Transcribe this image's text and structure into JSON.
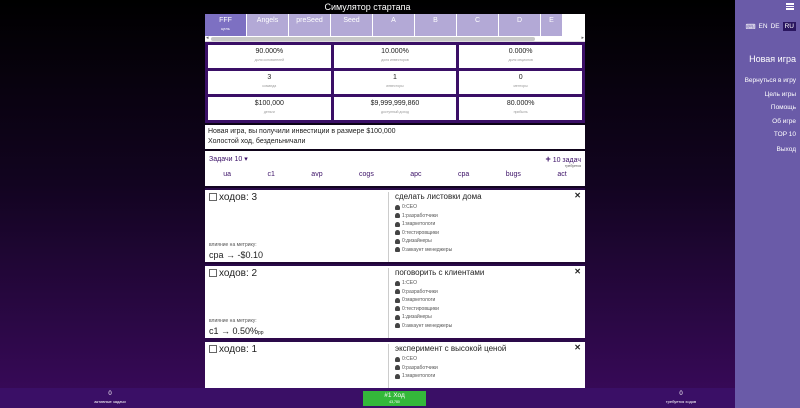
{
  "title": "Симулятор стартапа",
  "tabs": [
    {
      "label": "FFF",
      "sub": "цель"
    },
    {
      "label": "Angels",
      "sub": ""
    },
    {
      "label": "preSeed",
      "sub": ""
    },
    {
      "label": "Seed",
      "sub": ""
    },
    {
      "label": "A",
      "sub": ""
    },
    {
      "label": "B",
      "sub": ""
    },
    {
      "label": "C",
      "sub": ""
    },
    {
      "label": "D",
      "sub": ""
    },
    {
      "label": "E",
      "sub": ""
    }
  ],
  "metrics": [
    {
      "value": "90.000%",
      "label": "доля основателей"
    },
    {
      "value": "10.000%",
      "label": "доля инвесторов"
    },
    {
      "value": "0.000%",
      "label": "доля опционов"
    },
    {
      "value": "3",
      "label": "команда"
    },
    {
      "value": "1",
      "label": "инвесторы"
    },
    {
      "value": "0",
      "label": "менторы"
    },
    {
      "value": "$100,000",
      "label": "деньги"
    },
    {
      "value": "$9,999,999,860",
      "label": "доступный доход"
    },
    {
      "value": "80.000%",
      "label": "прибыль"
    }
  ],
  "log": [
    "Новая игра, вы получили инвестиции в размере $100,000",
    "Холостой ход, бездельничали"
  ],
  "tasks_dropdown": "Задачи 10",
  "add_tasks": {
    "label": "10 задач",
    "sub": "требуется"
  },
  "metric_tabs": [
    "ua",
    "c1",
    "avp",
    "cogs",
    "apc",
    "cpa",
    "bugs",
    "act"
  ],
  "tasks": [
    {
      "moves": "ходов: 3",
      "name": "сделать листовки дома",
      "impact_label": "влияние на метрику:",
      "impact": "cpa → -$0.10",
      "impact_suffix": "",
      "reqs": [
        "0:CEO",
        "1:разработчики",
        "1:маркетологи",
        "0:тестировщики",
        "0:дизайнеры",
        "0:аккаунт менеджеры"
      ]
    },
    {
      "moves": "ходов: 2",
      "name": "поговорить с клиентами",
      "impact_label": "влияние на метрику:",
      "impact": "c1 → 0.50%",
      "impact_suffix": "pp",
      "reqs": [
        "1:CEO",
        "0:разработчики",
        "0:маркетологи",
        "0:тестировщики",
        "1:дизайнеры",
        "0:аккаунт менеджеры"
      ]
    },
    {
      "moves": "ходов: 1",
      "name": "эксперимент с высокой ценой",
      "impact_label": "",
      "impact": "",
      "impact_suffix": "",
      "reqs": [
        "0:CEO",
        "0:разработчики",
        "1:маркетологи"
      ]
    }
  ],
  "sidebar": {
    "langs": [
      "EN",
      "DE",
      "RU"
    ],
    "new_game": "Новая игра",
    "menu": [
      "Вернуться в игру",
      "Цель игры",
      "Помощь",
      "Об игре",
      "TOP 10"
    ],
    "exit": "Выход"
  },
  "bottom": {
    "active_tasks_value": "0",
    "active_tasks_label": "активные задачи",
    "next_move": "#1 Ход",
    "next_move_sub": "43,780",
    "required_moves_value": "0",
    "required_moves_label": "требуется ходов"
  }
}
